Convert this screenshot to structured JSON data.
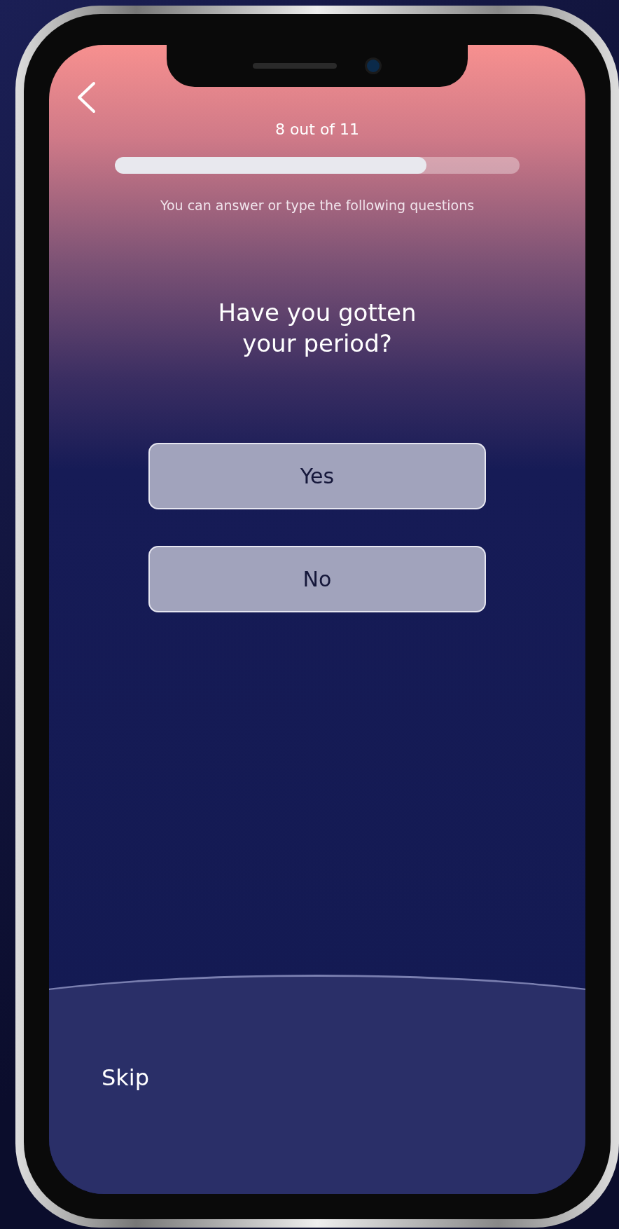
{
  "header": {
    "progress_text": "8 out of 11",
    "level": 0.77,
    "subtitle": "You can answer or type the following questions"
  },
  "question": "Have you gotten your period?",
  "options": [
    {
      "label": "Yes",
      "selected": false
    },
    {
      "label": "No",
      "selected": false
    }
  ],
  "footer": {
    "skip": "Skip"
  }
}
